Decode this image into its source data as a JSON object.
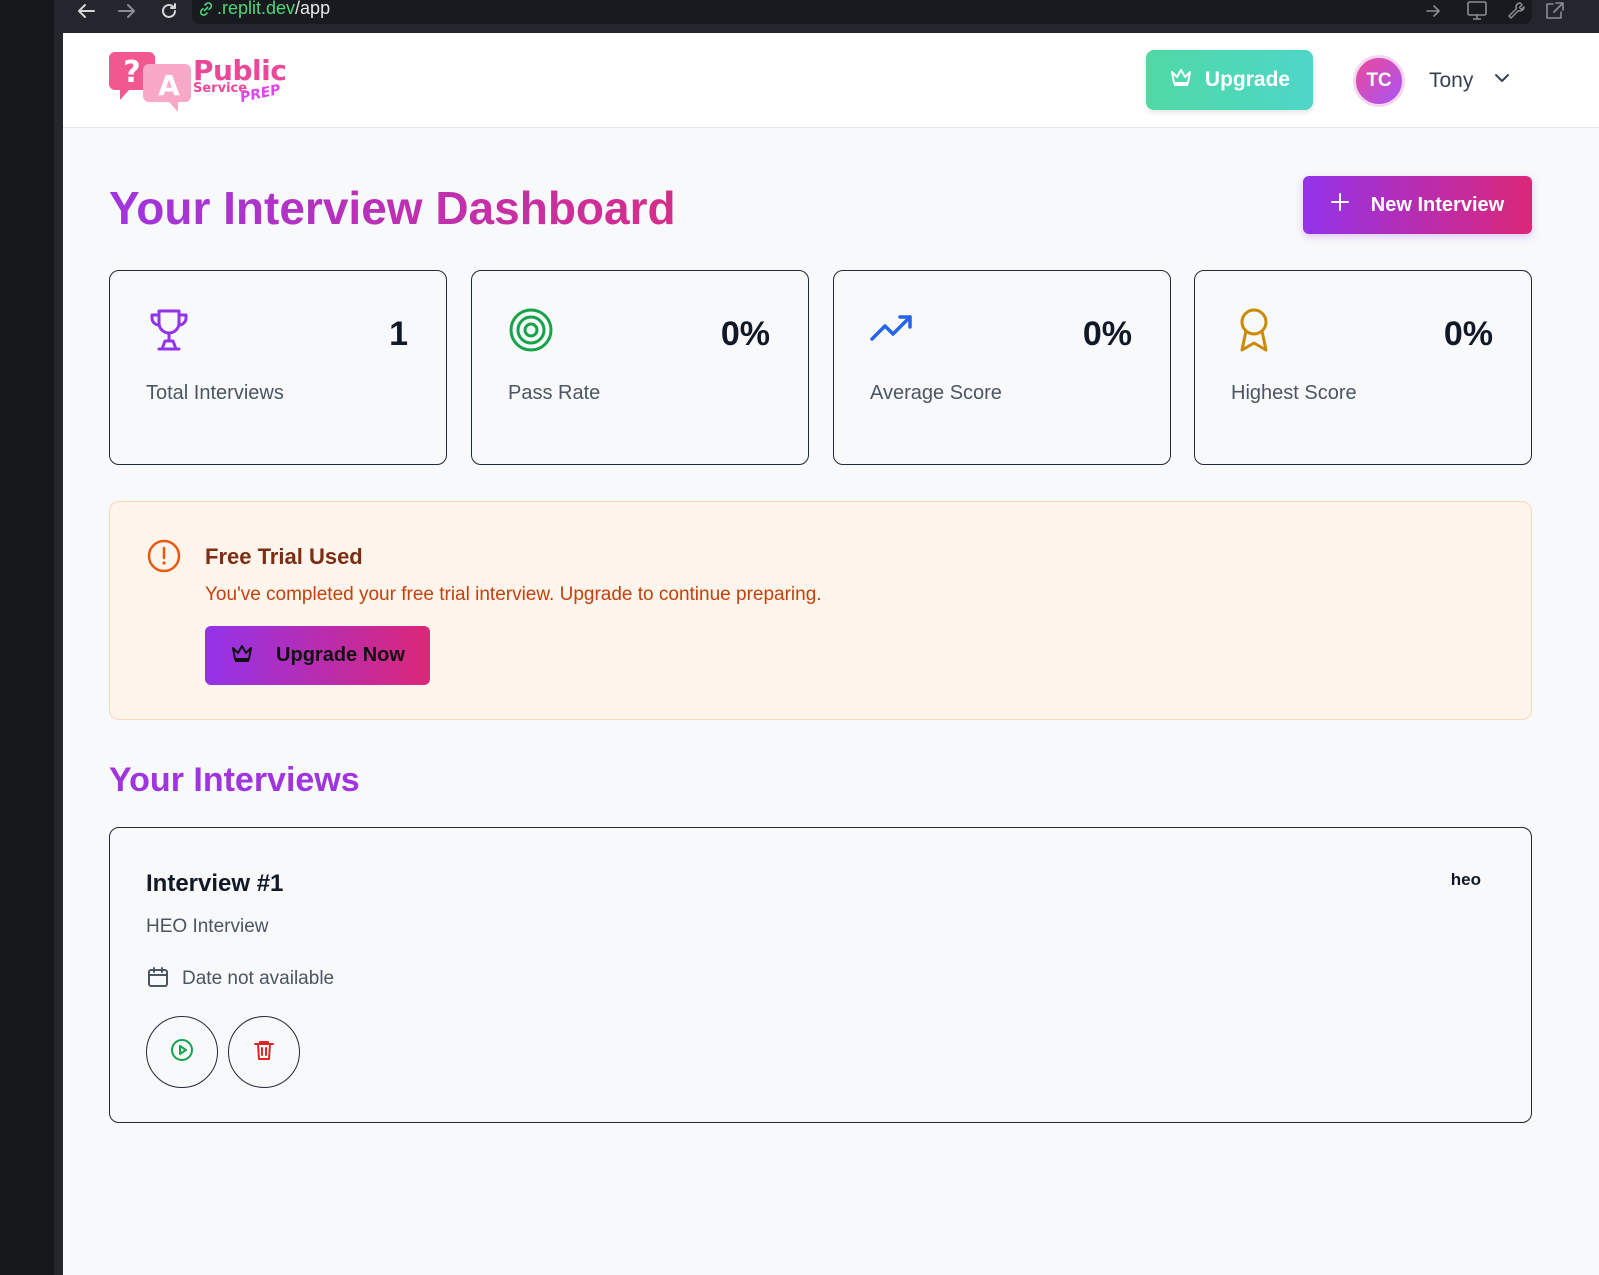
{
  "browser": {
    "url_host": ".replit.dev",
    "url_path": "/app"
  },
  "header": {
    "logo": {
      "word1": "Public",
      "word2": "Service",
      "word3": "PREP"
    },
    "upgrade_label": "Upgrade",
    "user": {
      "initials": "TC",
      "name": "Tony"
    }
  },
  "main": {
    "title": "Your Interview Dashboard",
    "new_interview_label": "New Interview",
    "stats": [
      {
        "icon": "trophy-icon",
        "value": "1",
        "label": "Total Interviews",
        "color": "#9333ea"
      },
      {
        "icon": "target-icon",
        "value": "0%",
        "label": "Pass Rate",
        "color": "#16a34a"
      },
      {
        "icon": "trending-up-icon",
        "value": "0%",
        "label": "Average Score",
        "color": "#2563eb"
      },
      {
        "icon": "award-icon",
        "value": "0%",
        "label": "Highest Score",
        "color": "#ca8a04"
      }
    ],
    "trial": {
      "title": "Free Trial Used",
      "message": "You've completed your free trial interview. Upgrade to continue preparing.",
      "button_label": "Upgrade Now"
    },
    "interviews_title": "Your Interviews",
    "interviews": [
      {
        "title": "Interview #1",
        "type": "HEO Interview",
        "date": "Date not available",
        "tag": "heo"
      }
    ]
  },
  "colors": {
    "accent_purple": "#9333ea",
    "accent_pink": "#db2777",
    "teal": "#4fd6c9",
    "warning_orange": "#ea580c"
  }
}
